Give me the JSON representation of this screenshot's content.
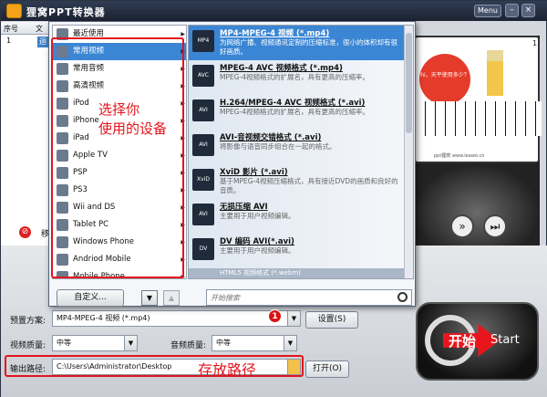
{
  "window": {
    "title": "狸窝PPT转换器",
    "menu_label": "Menu",
    "min_label": "–",
    "close_label": "×"
  },
  "table": {
    "col_seq": "序号",
    "col_file": "文",
    "row_seq": "1",
    "row_file": "迴"
  },
  "preview": {
    "num": "1",
    "ball_text": "hi，天平使用多少？",
    "footer": "ppt狸窝 www.leawo.cn"
  },
  "devices": [
    {
      "label": "最近使用",
      "icon": "clock-icon"
    },
    {
      "label": "常用视频",
      "icon": "film-icon",
      "selected": true
    },
    {
      "label": "常用音频",
      "icon": "music-icon"
    },
    {
      "label": "高清视频",
      "icon": "hd-icon"
    },
    {
      "label": "iPod",
      "icon": "ipod-icon"
    },
    {
      "label": "iPhone",
      "icon": "iphone-icon"
    },
    {
      "label": "iPad",
      "icon": "ipad-icon"
    },
    {
      "label": "Apple TV",
      "icon": "apple-tv-icon"
    },
    {
      "label": "PSP",
      "icon": "psp-icon"
    },
    {
      "label": "PS3",
      "icon": "ps3-icon"
    },
    {
      "label": "Wii and DS",
      "icon": "wii-icon"
    },
    {
      "label": "Tablet PC",
      "icon": "tablet-icon"
    },
    {
      "label": "Windows Phone",
      "icon": "windows-phone-icon"
    },
    {
      "label": "Andriod Mobile",
      "icon": "android-icon"
    },
    {
      "label": "Mobile Phone",
      "icon": "mobile-phone-icon"
    }
  ],
  "formats": [
    {
      "title": "MP4-MPEG-4 视频 (*.mp4)",
      "desc": "为网络广播、视频通讯定制的压缩标准，很小的体积却有很好画质。",
      "icon": "MP4",
      "selected": true
    },
    {
      "title": "MPEG-4 AVC 视频格式 (*.mp4)",
      "desc": "MPEG-4视频格式的扩展名，具有更高的压缩率。",
      "icon": "AVC"
    },
    {
      "title": "H.264/MPEG-4 AVC 视频格式 (*.avi)",
      "desc": "MPEG-4视频格式的扩展名，具有更高的压缩率。",
      "icon": "AVI"
    },
    {
      "title": "AVI-音视频交错格式 (*.avi)",
      "desc": "将影像与语音同步组合在一起的格式。",
      "icon": "AVI"
    },
    {
      "title": "XviD 影片 (*.avi)",
      "desc": "基于MPEG-4视频压缩格式，具有接近DVD的画质和良好的音质。",
      "icon": "XviD"
    },
    {
      "title": "无损压缩 AVI",
      "desc": "主要用于用户视频编辑。",
      "icon": "AVI"
    },
    {
      "title": "DV 编码 AVI(*.avi)",
      "desc": "主要用于用户视频编辑。",
      "icon": "DV"
    }
  ],
  "format_partial": "HTML5 视频格式 (*.webm)",
  "popup": {
    "customize": "自定义...",
    "search_placeholder": "开始搜索",
    "down": "▼",
    "up": "▲"
  },
  "annotations": {
    "choose_device": "选择你\n使用的设备",
    "save_path": "存放路径",
    "badge": "1"
  },
  "bottom": {
    "move_label": "移",
    "preset_label": "预置方案:",
    "preset_value": "MP4-MPEG-4 视频 (*.mp4)",
    "settings_btn": "设置(S)",
    "video_quality_label": "视频质量:",
    "video_quality_value": "中等",
    "audio_quality_label": "音频质量:",
    "audio_quality_value": "中等",
    "output_label": "输出路径:",
    "output_value": "C:\\Users\\Administrator\\Desktop",
    "open_btn": "打开(O)",
    "start_cn": "开始",
    "start_en": "Start"
  },
  "colors": {
    "accent": "#3b86d4",
    "annotation": "#e3141d",
    "titlebar": "#1d2433"
  }
}
